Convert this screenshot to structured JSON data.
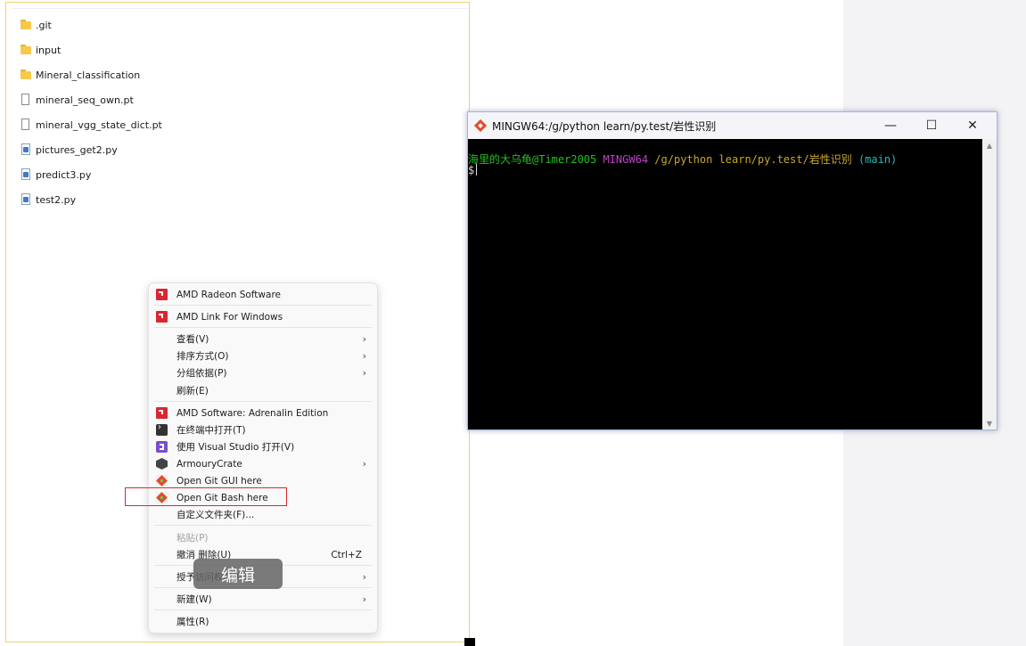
{
  "explorer": {
    "files": [
      {
        "name": ".git",
        "icon": "folder-icon"
      },
      {
        "name": "input",
        "icon": "folder-icon"
      },
      {
        "name": "Mineral_classification",
        "icon": "folder-icon"
      },
      {
        "name": "mineral_seq_own.pt",
        "icon": "file-icon"
      },
      {
        "name": "mineral_vgg_state_dict.pt",
        "icon": "file-icon"
      },
      {
        "name": "pictures_get2.py",
        "icon": "python-file-icon"
      },
      {
        "name": "predict3.py",
        "icon": "python-file-icon"
      },
      {
        "name": "test2.py",
        "icon": "python-file-icon"
      }
    ]
  },
  "terminal": {
    "title": "MINGW64:/g/python learn/py.test/岩性识别",
    "controls": {
      "minimize": "—",
      "maximize": "☐",
      "close": "✕"
    },
    "prompt": {
      "user": "海里的大乌龟@Timer2005",
      "system": "MINGW64",
      "path": "/g/python learn/py.test/岩性识别",
      "branch": "(main)",
      "symbol": "$"
    }
  },
  "context_menu": {
    "amd_radeon": "AMD Radeon Software",
    "amd_link": "AMD Link For Windows",
    "view": "查看(V)",
    "sort_by": "排序方式(O)",
    "group_by": "分组依据(P)",
    "refresh": "刷新(E)",
    "amd_adrenalin": "AMD Software: Adrenalin Edition",
    "open_terminal": "在终端中打开(T)",
    "open_vs": "使用 Visual Studio 打开(V)",
    "armoury": "ArmouryCrate",
    "git_gui": "Open Git GUI here",
    "git_bash": "Open Git Bash here",
    "customize": "自定义文件夹(F)...",
    "paste": "粘贴(P)",
    "undo_delete": "撤消 删除(U)",
    "undo_shortcut": "Ctrl+Z",
    "grant_access": "授予访问权限(G)",
    "new": "新建(W)",
    "properties": "属性(R)",
    "arrow": "›"
  },
  "overlay": {
    "edit_label": "编辑"
  }
}
